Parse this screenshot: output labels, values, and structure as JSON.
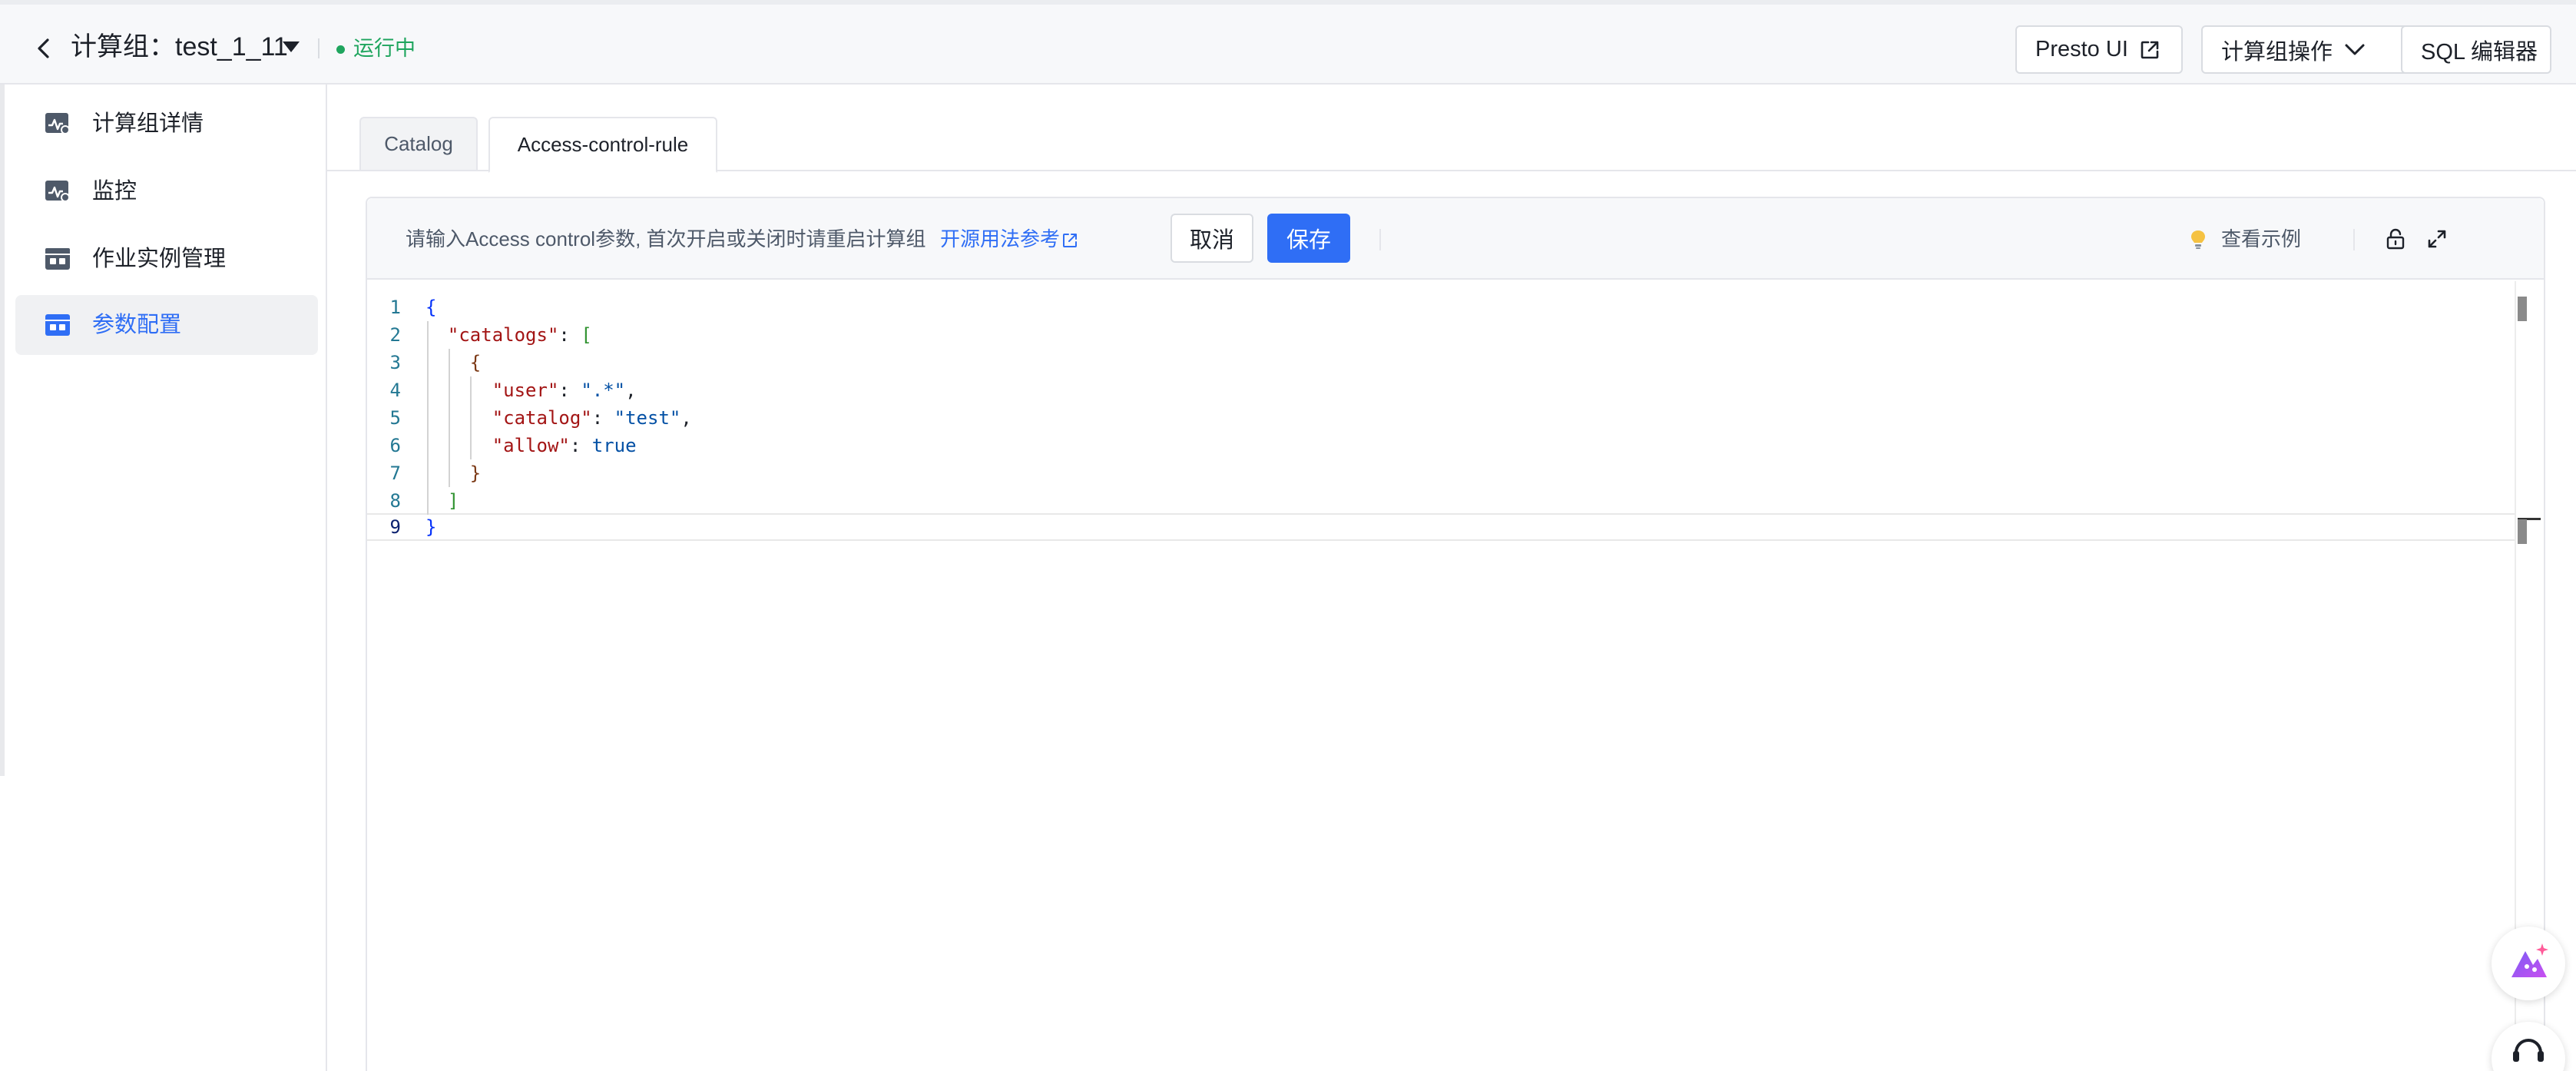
{
  "header": {
    "title": "计算组：test_1_11",
    "status": "运行中",
    "buttons": {
      "presto_ui": "Presto UI",
      "compute_group_ops": "计算组操作",
      "sql_editor": "SQL 编辑器"
    }
  },
  "sidebar": {
    "items": [
      {
        "label": "计算组详情",
        "icon": "monitor-chart-icon",
        "active": false
      },
      {
        "label": "监控",
        "icon": "monitor-chart-icon",
        "active": false
      },
      {
        "label": "作业实例管理",
        "icon": "job-window-icon",
        "active": false
      },
      {
        "label": "参数配置",
        "icon": "config-window-icon",
        "active": true
      }
    ]
  },
  "tabs": [
    {
      "label": "Catalog",
      "active": false
    },
    {
      "label": "Access-control-rule",
      "active": true
    }
  ],
  "editor": {
    "hint": "请输入Access control参数, 首次开启或关闭时请重启计算组",
    "hint_link": "开源用法参考",
    "cancel_label": "取消",
    "save_label": "保存",
    "example_label": "查看示例",
    "line_numbers": [
      "1",
      "2",
      "3",
      "4",
      "5",
      "6",
      "7",
      "8",
      "9"
    ],
    "current_line": 9,
    "code": {
      "key_catalogs": "\"catalogs\"",
      "key_user": "\"user\"",
      "val_user": "\".*\"",
      "key_catalog": "\"catalog\"",
      "val_catalog": "\"test\"",
      "key_allow": "\"allow\"",
      "val_allow": "true"
    }
  },
  "colors": {
    "accent": "#2f6ef5",
    "status": "#1fa55e"
  }
}
